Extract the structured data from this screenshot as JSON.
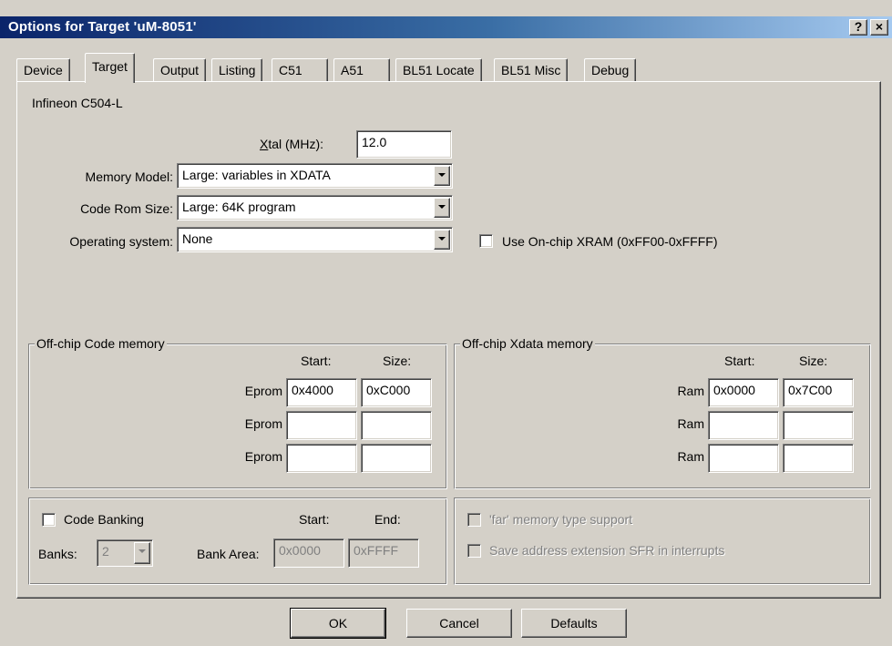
{
  "window": {
    "title": "Options for Target 'uM-8051'",
    "help_button": "?",
    "close_button": "×"
  },
  "tabs": [
    {
      "label": "Device",
      "active": false
    },
    {
      "label": "Target",
      "active": true
    },
    {
      "label": "Output",
      "active": false
    },
    {
      "label": "Listing",
      "active": false
    },
    {
      "label": "C51",
      "active": false
    },
    {
      "label": "A51",
      "active": false
    },
    {
      "label": "BL51 Locate",
      "active": false
    },
    {
      "label": "BL51 Misc",
      "active": false
    },
    {
      "label": "Debug",
      "active": false
    }
  ],
  "device_name": "Infineon C504-L",
  "xtal": {
    "label_mnemonic": "X",
    "label_rest": "tal (MHz):",
    "value": "12.0"
  },
  "memory_model": {
    "label": "Memory Model:",
    "value": "Large: variables in XDATA"
  },
  "code_rom_size": {
    "label": "Code Rom Size:",
    "value": "Large: 64K program"
  },
  "operating_system": {
    "label": "Operating system:",
    "value": "None"
  },
  "use_onchip_xram": {
    "label": "Use On-chip XRAM (0xFF00-0xFFFF)",
    "checked": false
  },
  "offchip_code": {
    "legend": "Off-chip Code memory",
    "start_header": "Start:",
    "size_header": "Size:",
    "rows": [
      {
        "label": "Eprom",
        "start": "0x4000",
        "size": "0xC000"
      },
      {
        "label": "Eprom",
        "start": "",
        "size": ""
      },
      {
        "label": "Eprom",
        "start": "",
        "size": ""
      }
    ]
  },
  "offchip_xdata": {
    "legend": "Off-chip Xdata memory",
    "start_header": "Start:",
    "size_header": "Size:",
    "rows": [
      {
        "label": "Ram",
        "start": "0x0000",
        "size": "0x7C00"
      },
      {
        "label": "Ram",
        "start": "",
        "size": ""
      },
      {
        "label": "Ram",
        "start": "",
        "size": ""
      }
    ]
  },
  "banking": {
    "code_banking_label": "Code Banking",
    "checked": false,
    "banks_label": "Banks:",
    "banks_value": "2",
    "bank_area_label": "Bank Area:",
    "start_header": "Start:",
    "end_header": "End:",
    "start_value": "0x0000",
    "end_value": "0xFFFF"
  },
  "far_options": {
    "far_memory_label": "'far' memory type support",
    "save_sfr_label": "Save address extension SFR in interrupts"
  },
  "buttons": {
    "ok": "OK",
    "cancel": "Cancel",
    "defaults": "Defaults"
  }
}
